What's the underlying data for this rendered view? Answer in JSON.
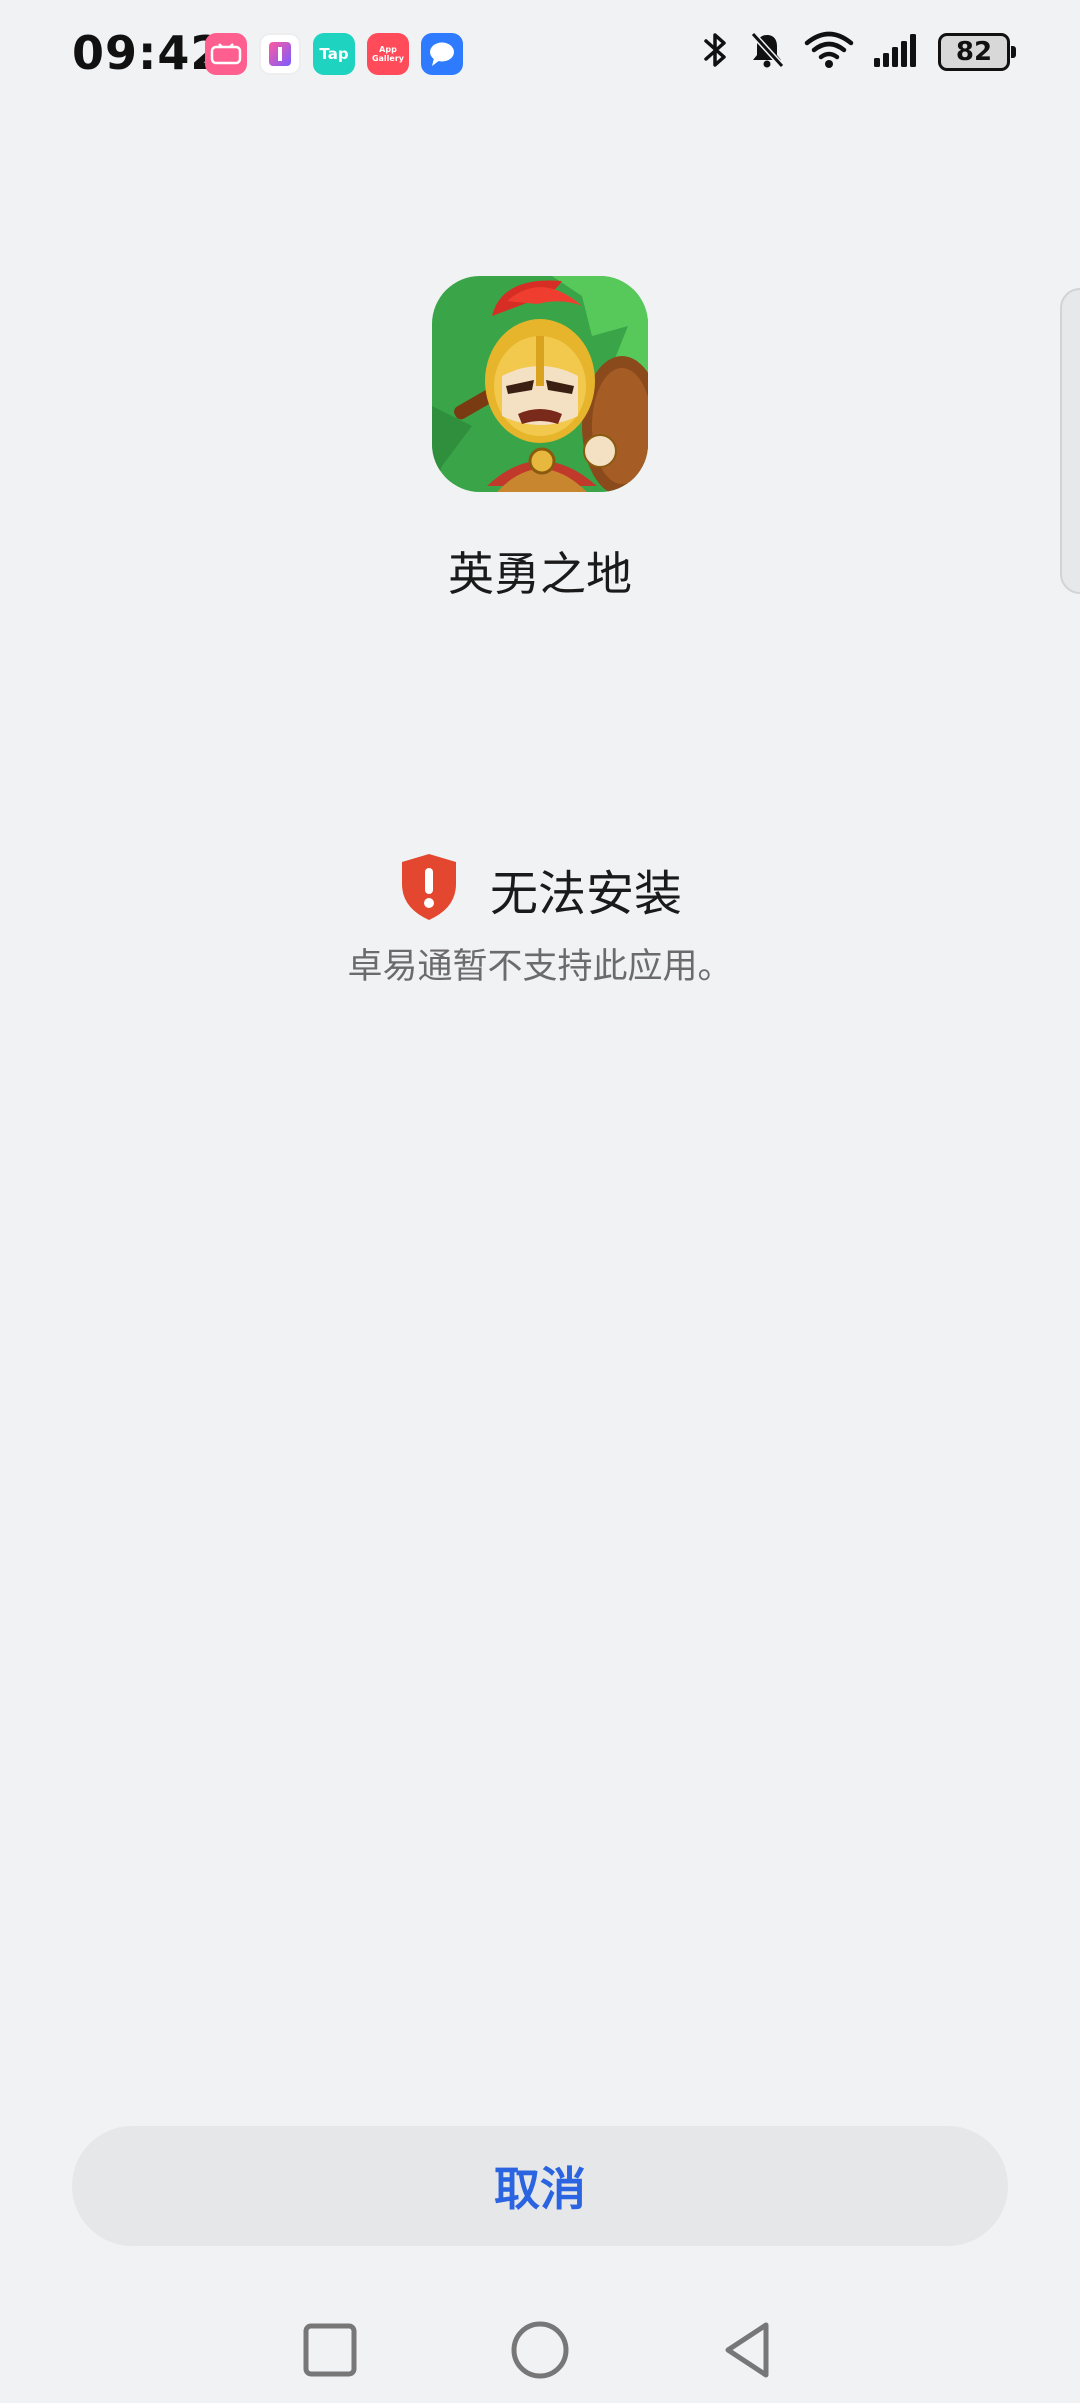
{
  "status_bar": {
    "time": "09:42",
    "notification_icons": [
      "bilibili-icon",
      "ibox-icon",
      "taptap-icon",
      "app-gallery-icon",
      "messages-icon"
    ],
    "tap_label": "Tap",
    "gallery_label": "App Gallery",
    "battery": "82"
  },
  "app": {
    "name": "英勇之地",
    "icon": "spartan-warrior-app-icon"
  },
  "error": {
    "title": "无法安装",
    "description": "卓易通暂不支持此应用。",
    "color": "#e4472f"
  },
  "actions": {
    "cancel_label": "取消",
    "accent_color": "#2a64e0"
  },
  "navigation": {
    "buttons": [
      "recents-icon",
      "home-icon",
      "back-icon"
    ]
  }
}
